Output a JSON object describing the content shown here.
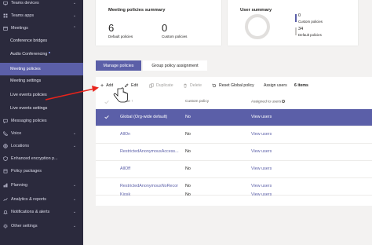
{
  "sidebar": {
    "items": [
      {
        "label": "Teams devices",
        "icon": "devices-icon",
        "chevron": "⌄",
        "active": false,
        "sub": false
      },
      {
        "label": "Teams apps",
        "icon": "apps-icon",
        "chevron": "⌄",
        "active": false,
        "sub": false
      },
      {
        "label": "Meetings",
        "icon": "calendar-icon",
        "chevron": "⌃",
        "active": false,
        "sub": false
      },
      {
        "label": "Conference bridges",
        "icon": "",
        "chevron": "",
        "active": false,
        "sub": true
      },
      {
        "label": "Audio Conferencing",
        "icon": "",
        "chevron": "",
        "active": false,
        "sub": true,
        "dot": true
      },
      {
        "label": "Meeting policies",
        "icon": "",
        "chevron": "",
        "active": true,
        "sub": true
      },
      {
        "label": "Meeting settings",
        "icon": "",
        "chevron": "",
        "active": false,
        "sub": true
      },
      {
        "label": "Live events policies",
        "icon": "",
        "chevron": "",
        "active": false,
        "sub": true
      },
      {
        "label": "Live events settings",
        "icon": "",
        "chevron": "",
        "active": false,
        "sub": true
      },
      {
        "label": "Messaging policies",
        "icon": "chat-icon",
        "chevron": "",
        "active": false,
        "sub": false
      },
      {
        "label": "Voice",
        "icon": "phone-icon",
        "chevron": "⌄",
        "active": false,
        "sub": false
      },
      {
        "label": "Locations",
        "icon": "globe-icon",
        "chevron": "⌄",
        "active": false,
        "sub": false
      },
      {
        "label": "Enhanced encryption p...",
        "icon": "shield-icon",
        "chevron": "",
        "active": false,
        "sub": false
      },
      {
        "label": "Policy packages",
        "icon": "package-icon",
        "chevron": "",
        "active": false,
        "sub": false
      },
      {
        "label": "Planning",
        "icon": "planning-icon",
        "chevron": "⌄",
        "active": false,
        "sub": false
      },
      {
        "label": "Analytics & reports",
        "icon": "analytics-icon",
        "chevron": "⌄",
        "active": false,
        "sub": false
      },
      {
        "label": "Notifications & alerts",
        "icon": "bell-icon",
        "chevron": "⌄",
        "active": false,
        "sub": false
      },
      {
        "label": "Other settings",
        "icon": "gear-icon",
        "chevron": "⌄",
        "active": false,
        "sub": false
      }
    ]
  },
  "summary": {
    "title": "Meeting policies summary",
    "default_count": "6",
    "default_label": "Default policies",
    "custom_count": "0",
    "custom_label": "Custom policies"
  },
  "user_summary": {
    "title": "User summary",
    "custom_count": "0",
    "custom_label": "Custom policies",
    "default_count": "34",
    "default_label": "Default policies"
  },
  "tabs": {
    "manage": "Manage policies",
    "group": "Group policy assignment"
  },
  "toolbar": {
    "add": "Add",
    "edit": "Edit",
    "duplicate": "Duplicate",
    "delete": "Delete",
    "reset": "Reset Global policy",
    "assign": "Assign users",
    "count": "6 items"
  },
  "table": {
    "headers": [
      "Name ↑",
      "Custom policy",
      "Assigned to users"
    ],
    "rows": [
      {
        "name": "Global (Org-wide default)",
        "custom": "No",
        "assigned": "View users",
        "selected": true
      },
      {
        "name": "AllOn",
        "custom": "No",
        "assigned": "View users",
        "selected": false
      },
      {
        "name": "RestrictedAnonymousAccess...",
        "custom": "No",
        "assigned": "View users",
        "selected": false
      },
      {
        "name": "AllOff",
        "custom": "No",
        "assigned": "View users",
        "selected": false
      },
      {
        "name": "RestrictedAnonymousNoRecor",
        "custom": "No",
        "assigned": "View users",
        "selected": false
      },
      {
        "name": "Kiosk",
        "custom": "No",
        "assigned": "View users",
        "selected": false
      }
    ]
  },
  "colors": {
    "accent": "#5b5fa8",
    "sidebar_bg": "#2b2a3d",
    "arrow": "#e8231b"
  }
}
